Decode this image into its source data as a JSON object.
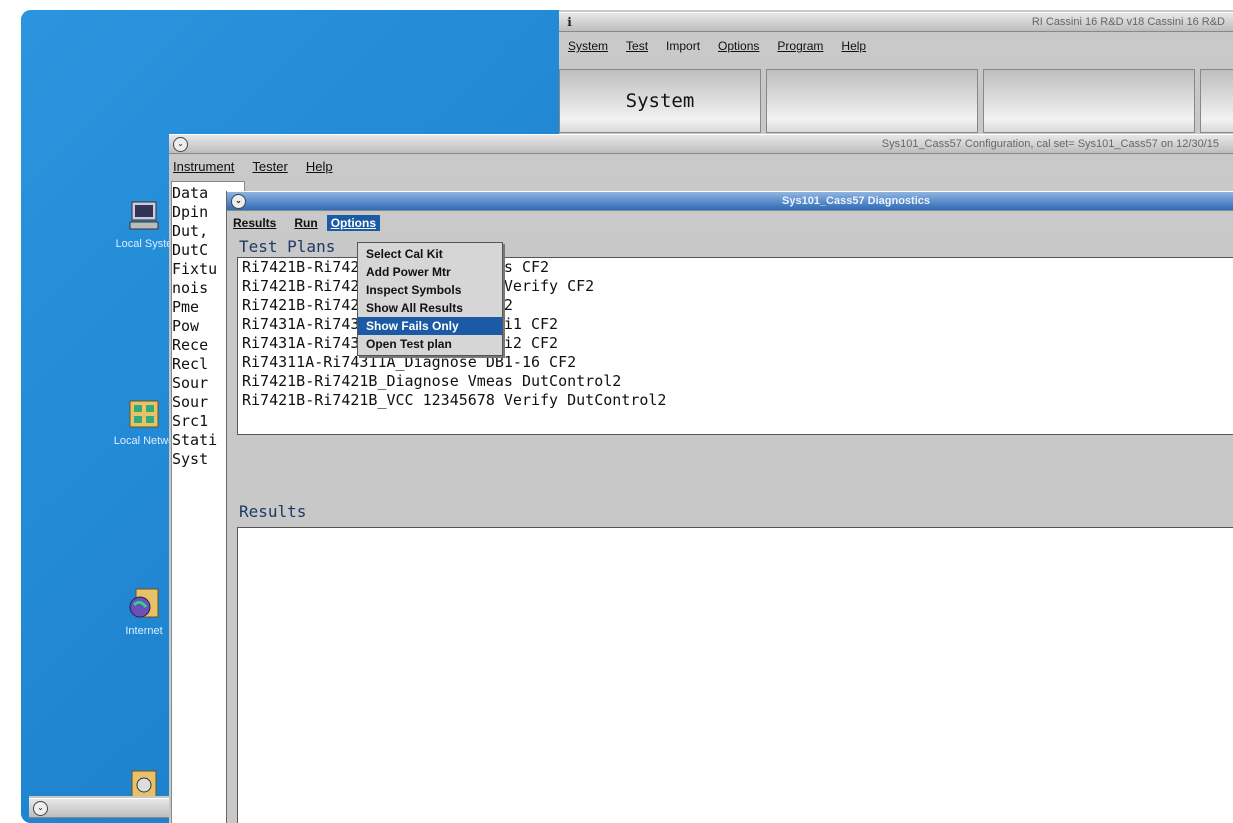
{
  "desktop": {
    "icons": [
      {
        "name": "computer-icon",
        "label": "Local Syste"
      },
      {
        "name": "network-icon",
        "label": "Local Netwo"
      },
      {
        "name": "internet-icon",
        "label": "Internet"
      },
      {
        "name": "folder-icon",
        "label": ""
      }
    ]
  },
  "main_window": {
    "title": "RI Cassini 16 R&D v18  Cassini 16 R&D",
    "menu": [
      "System",
      "Test",
      "Import",
      "Options",
      "Program",
      "Help"
    ],
    "tool_buttons": [
      "System",
      "",
      "",
      ""
    ]
  },
  "config_window": {
    "title": "Sys101_Cass57 Configuration,  cal set= Sys101_Cass57 on 12/30/15",
    "menu": [
      "Instrument",
      "Tester",
      "Help"
    ],
    "list_items": [
      "Data",
      "Dpin",
      "Dut,",
      "DutC",
      "Fixtu",
      "nois",
      "Pme",
      "Pow",
      "Rece",
      "Recl",
      "Sour",
      "Sour",
      "Src1",
      "Stati",
      "Syst"
    ]
  },
  "diag_window": {
    "title": "Sys101_Cass57 Diagnostics",
    "menu": [
      "Results",
      "Run",
      "Options"
    ],
    "test_plans_label": "Test Plans",
    "test_plans": [
      "Ri7421B-Ri7421B_Diagnose Vmeas CF2",
      "Ri7421B-Ri7421B_VCC 12345678 Verify CF2",
      "Ri7421B-Ri7421B_CMP Verify CF2",
      "Ri7431A-Ri7431A_Verify PowerVi1 CF2",
      "Ri7431A-Ri7431A_Verify PowerVi2 CF2",
      "Ri74311A-Ri74311A_Diagnose DB1-16 CF2",
      "Ri7421B-Ri7421B_Diagnose Vmeas DutControl2",
      "Ri7421B-Ri7421B_VCC 12345678 Verify DutControl2"
    ],
    "results_label": "Results"
  },
  "options_menu": {
    "items": [
      "Select Cal Kit",
      "Add Power Mtr",
      "Inspect Symbols",
      "Show All Results",
      "Show Fails Only",
      "Open Test plan"
    ],
    "selected": "Show Fails Only"
  },
  "colors": {
    "desktop": "#1f84cf",
    "selection": "#1b5aa5",
    "window": "#c8c8c8"
  }
}
